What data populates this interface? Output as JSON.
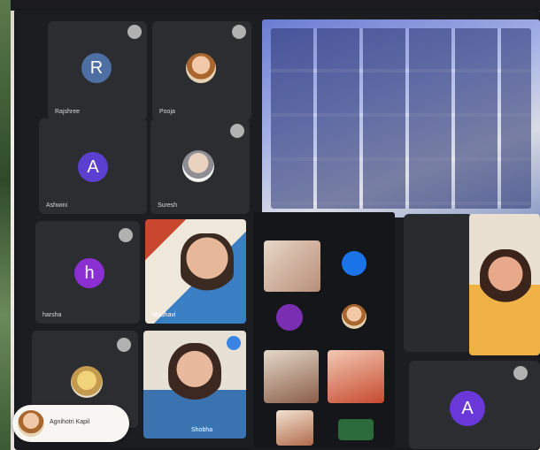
{
  "participants": [
    {
      "initial": "R",
      "name": "Rajshree",
      "color": "#4d6fa3"
    },
    {
      "initial": "",
      "name": "Pooja",
      "color": "#c8a17a"
    },
    {
      "initial": "A",
      "name": "Ashwini",
      "color": "#5b3fd1"
    },
    {
      "initial": "",
      "name": "Suresh",
      "color": "#d3b398"
    },
    {
      "initial": "h",
      "name": "harsha",
      "color": "#8b2fd3"
    },
    {
      "initial": "",
      "name": "",
      "color": "#d9b46a"
    },
    {
      "initial": "A",
      "name": "",
      "color": "#6a38d9"
    }
  ],
  "video_labels": {
    "v1": "Madhavi",
    "v2": "Shobha"
  },
  "pill_label": "Agnihotri Kapil",
  "accent": "#1a73e8"
}
